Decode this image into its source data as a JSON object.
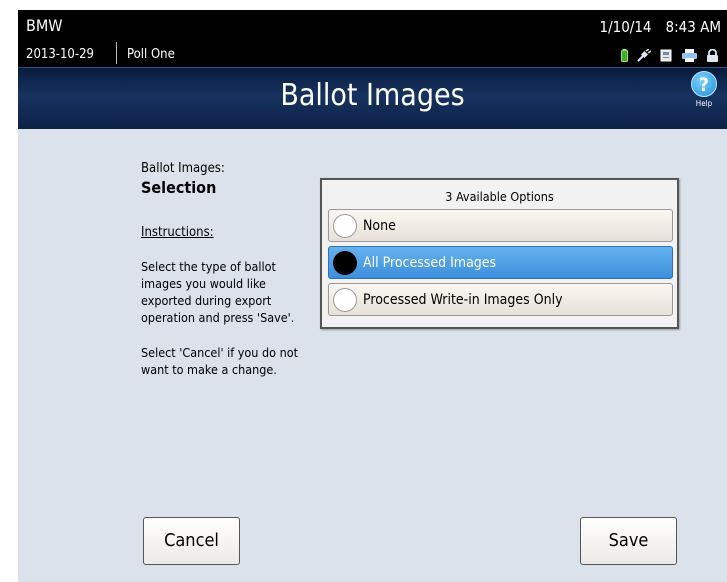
{
  "status_bar": {
    "system_name": "BMW",
    "election_date": "2013-10-29",
    "poll_name": "Poll One",
    "date": "1/10/14",
    "time": "8:43 AM",
    "icons": [
      "battery-icon",
      "power-plug-icon",
      "document-icon",
      "printer-icon",
      "lock-icon"
    ]
  },
  "title_bar": {
    "title": "Ballot Images",
    "help_symbol": "?",
    "help_label": "Help"
  },
  "instructions_panel": {
    "subtitle": "Ballot Images:",
    "heading": "Selection",
    "instructions_label": "Instructions:",
    "paragraph_1": "Select the type of ballot images you would like exported during export operation and press 'Save'.",
    "paragraph_2": "Select 'Cancel' if you do not want to make a change."
  },
  "options": {
    "header": "3 Available Options",
    "items": [
      {
        "label": "None",
        "selected": false
      },
      {
        "label": "All Processed Images",
        "selected": true
      },
      {
        "label": "Processed Write-in Images Only",
        "selected": false
      }
    ]
  },
  "buttons": {
    "cancel": "Cancel",
    "save": "Save"
  },
  "colors": {
    "status_bar_bg": "#000000",
    "title_bar_bg": "#16325f",
    "content_bg": "#dbe2ec",
    "selected_option": "#4a9de6"
  }
}
